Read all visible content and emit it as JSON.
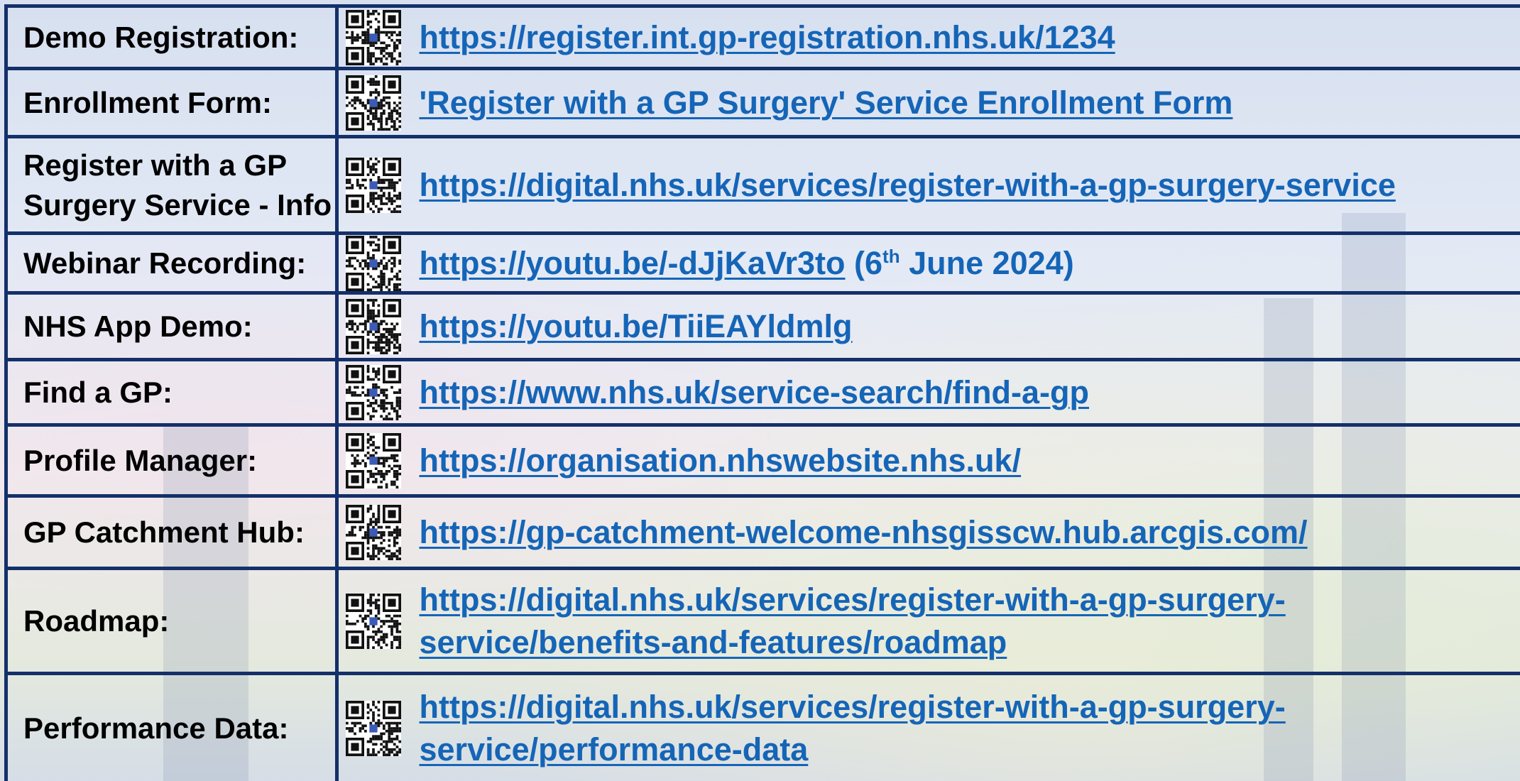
{
  "rows": [
    {
      "label": "Demo Registration:",
      "link": "https://register.int.gp-registration.nhs.uk/1234"
    },
    {
      "label": "Enrollment Form:",
      "link": "'Register with a GP Surgery' Service Enrollment Form"
    },
    {
      "label": "Register with a GP Surgery Service - Info",
      "link": "https://digital.nhs.uk/services/register-with-a-gp-surgery-service"
    },
    {
      "label": "Webinar Recording:",
      "link": "https://youtu.be/-dJjKaVr3to",
      "note_pre": " (6",
      "note_sup": "th",
      "note_post": " June 2024)"
    },
    {
      "label": "NHS App Demo:",
      "link": "https://youtu.be/TiiEAYldmlg"
    },
    {
      "label": "Find a GP:",
      "link": "https://www.nhs.uk/service-search/find-a-gp"
    },
    {
      "label": "Profile Manager:",
      "link": "https://organisation.nhswebsite.nhs.uk/"
    },
    {
      "label": "GP Catchment Hub:",
      "link": "https://gp-catchment-welcome-nhsgisscw.hub.arcgis.com/"
    },
    {
      "label": "Roadmap:",
      "link": "https://digital.nhs.uk/services/register-with-a-gp-surgery-service/benefits-and-features/roadmap",
      "link_line1": "https://digital.nhs.uk/services/register-with-a-gp-surgery-",
      "link_line2": "service/benefits-and-features/roadmap"
    },
    {
      "label": "Performance Data:",
      "link": "https://digital.nhs.uk/services/register-with-a-gp-surgery-service/performance-data",
      "link_line1": "https://digital.nhs.uk/services/register-with-a-gp-surgery-",
      "link_line2": "service/performance-data"
    }
  ],
  "colors": {
    "border": "#14306a",
    "link": "#1565b7",
    "label": "#000000"
  },
  "icons": {
    "qr": "qr-code-icon"
  }
}
